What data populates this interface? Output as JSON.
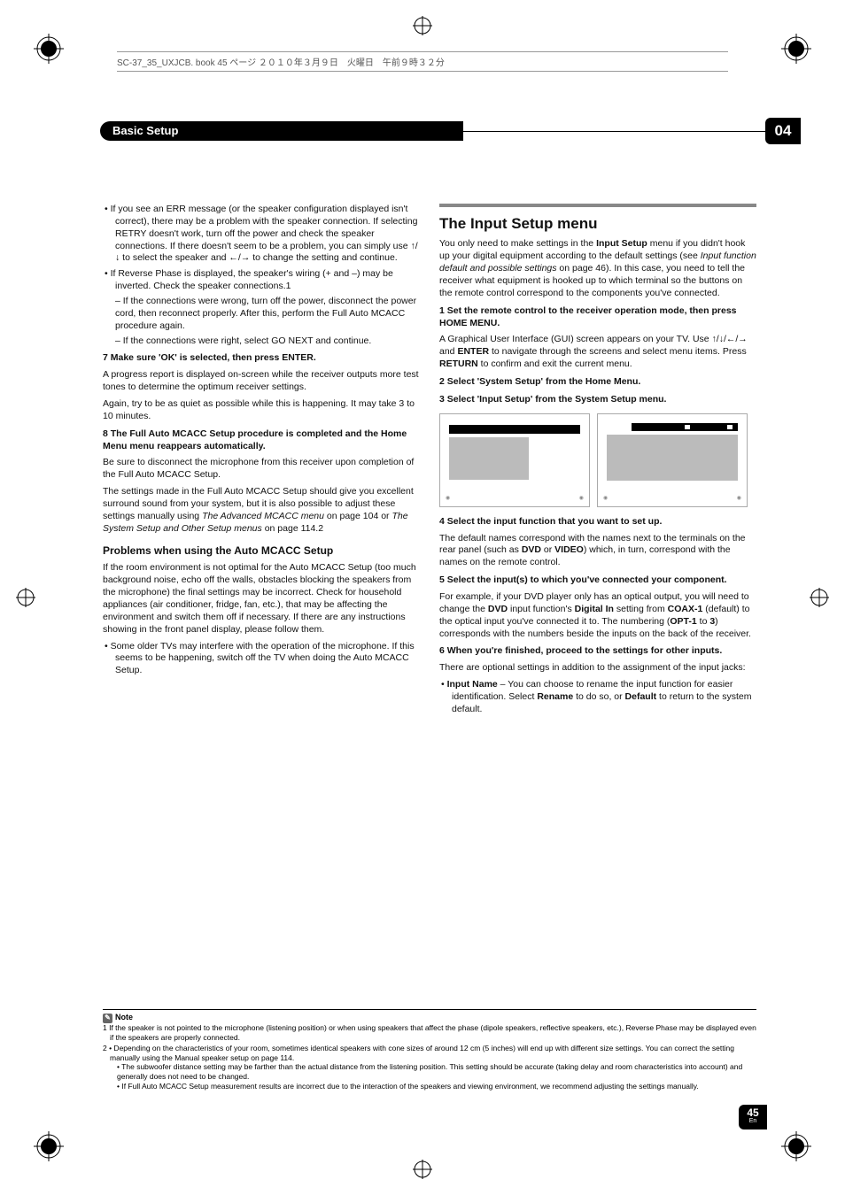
{
  "header": {
    "book_line": "SC-37_35_UXJCB. book  45 ページ  ２０１０年３月９日　火曜日　午前９時３２分"
  },
  "chapter": {
    "title": "Basic Setup",
    "number": "04"
  },
  "page": {
    "number": "45",
    "lang": "En"
  },
  "left": {
    "bullets1": [
      "If you see an ERR message (or the speaker configuration displayed isn't correct), there may be a problem with the speaker connection. If selecting RETRY doesn't work, turn off the power and check the speaker connections. If there doesn't seem to be a problem, you can simply use ↑/↓ to select the speaker and ←/→ to change the setting and continue.",
      "If Reverse Phase is displayed, the speaker's wiring (+ and –) may be inverted. Check the speaker connections.1"
    ],
    "sub1": "– If the connections were wrong, turn off the power, disconnect the power cord, then reconnect properly. After this, perform the Full Auto MCACC procedure again.",
    "sub2": "– If the connections were right, select GO NEXT and continue.",
    "step7_head": "7    Make sure 'OK' is selected, then press ENTER.",
    "step7_p1": "A progress report is displayed on-screen while the receiver outputs more test tones to determine the optimum receiver settings.",
    "step7_p2": "Again, try to be as quiet as possible while this is happening. It may take 3 to 10 minutes.",
    "step8_head": "8    The Full Auto MCACC Setup procedure is completed and the Home Menu menu reappears automatically.",
    "step8_p1": "Be sure to disconnect the microphone from this receiver upon completion of the Full Auto MCACC Setup.",
    "step8_p2a": "The settings made in the Full Auto MCACC Setup should give you excellent surround sound from your system, but it is also possible to adjust these settings manually using ",
    "step8_p2b": "The Advanced MCACC menu",
    "step8_p2c": " on page 104 or ",
    "step8_p2d": "The System Setup and Other Setup menus",
    "step8_p2e": " on page 114.2",
    "h3_problems": "Problems when using the Auto MCACC Setup",
    "problems_p": "If the room environment is not optimal for the Auto MCACC Setup (too much background noise, echo off the walls, obstacles blocking the speakers from the microphone) the final settings may be incorrect. Check for household appliances (air conditioner, fridge, fan, etc.), that may be affecting the environment and switch them off if necessary. If there are any instructions showing in the front panel display, please follow them.",
    "problems_bullet": "Some older TVs may interfere with the operation of the microphone. If this seems to be happening, switch off the TV when doing the Auto MCACC Setup."
  },
  "right": {
    "h2": "The Input Setup menu",
    "intro_a": "You only need to make settings in the ",
    "intro_b": "Input Setup",
    "intro_c": " menu if you didn't hook up your digital equipment according to the default settings (see ",
    "intro_d": "Input function default and possible settings",
    "intro_e": " on page 46). In this case, you need to tell the receiver what equipment is hooked up to which terminal so the buttons on the remote control correspond to the components you've connected.",
    "s1_head": "1    Set the remote control to the receiver operation mode, then press HOME MENU.",
    "s1_p_a": "A Graphical User Interface (GUI) screen appears on your TV. Use ↑/↓/←/→ and ",
    "s1_p_b": "ENTER",
    "s1_p_c": " to navigate through the screens and select menu items. Press ",
    "s1_p_d": "RETURN",
    "s1_p_e": " to confirm and exit the current menu.",
    "s2_head": "2    Select 'System Setup' from the Home Menu.",
    "s3_head": "3    Select 'Input Setup' from the System Setup menu.",
    "s4_head": "4    Select the input function that you want to set up.",
    "s4_p_a": "The default names correspond with the names next to the terminals on the rear panel (such as ",
    "s4_p_b": "DVD",
    "s4_p_c": " or ",
    "s4_p_d": "VIDEO",
    "s4_p_e": ") which, in turn, correspond with the names on the remote control.",
    "s5_head": "5    Select the input(s) to which you've connected your component.",
    "s5_p_a": "For example, if your DVD player only has an optical output, you will need to change the ",
    "s5_p_b": "DVD",
    "s5_p_c": " input function's ",
    "s5_p_d": "Digital In",
    "s5_p_e": " setting from ",
    "s5_p_f": "COAX-1",
    "s5_p_g": " (default) to the optical input you've connected it to. The numbering (",
    "s5_p_h": "OPT-1",
    "s5_p_i": " to ",
    "s5_p_j": "3",
    "s5_p_k": ") corresponds with the numbers beside the inputs on the back of the receiver.",
    "s6_head": "6    When you're finished, proceed to the settings for other inputs.",
    "s6_p": "There are optional settings in addition to the assignment of the input jacks:",
    "s6_bullet_a": "Input Name",
    "s6_bullet_b": " – You can choose to rename the input function for easier identification. Select ",
    "s6_bullet_c": "Rename",
    "s6_bullet_d": " to do so, or ",
    "s6_bullet_e": "Default",
    "s6_bullet_f": " to return to the system default."
  },
  "notes": {
    "label": "Note",
    "n1": "If the speaker is not pointed to the microphone (listening position) or when using speakers that affect the phase (dipole speakers, reflective speakers, etc.), Reverse Phase may be displayed even if the speakers are properly connected.",
    "n2a": "• Depending on the characteristics of your room, sometimes identical speakers with cone sizes of around 12 cm (5 inches) will end up with different size settings. You can correct the setting manually using the Manual speaker setup on page 114.",
    "n2b": "• The subwoofer distance setting may be farther than the actual distance from the listening position. This setting should be accurate (taking delay and room characteristics into account) and generally does not need to be changed.",
    "n2c": "• If Full Auto MCACC Setup measurement results are incorrect due to the interaction of the speakers and viewing environment, we recommend adjusting the settings manually."
  }
}
